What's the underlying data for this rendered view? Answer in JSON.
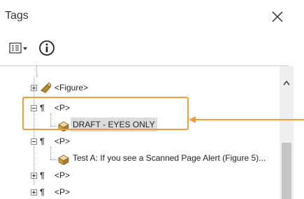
{
  "panel": {
    "title": "Tags"
  },
  "toolbar": {
    "options_icon": "options-list-icon",
    "info_icon": "info-icon"
  },
  "tree": {
    "rows": [
      {
        "label": "<Figure>"
      },
      {
        "label": "<P>"
      },
      {
        "label": "DRAFT - EYES ONLY"
      },
      {
        "label": "<P>"
      },
      {
        "label": "Test A: If you see a Scanned Page Alert (Figure 5)..."
      },
      {
        "label": "<P>"
      },
      {
        "label": "<P>"
      }
    ]
  },
  "colors": {
    "callout": "#f39a3a",
    "selection": "#dcdcdc"
  }
}
